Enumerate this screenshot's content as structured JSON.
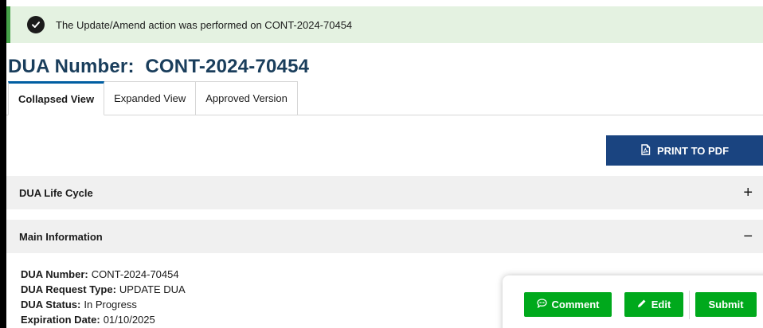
{
  "alert": {
    "icon": "check-circle-icon",
    "message": "The Update/Amend action was performed on CONT-2024-70454",
    "color": "#46a249"
  },
  "page_title": "DUA Number:  CONT-2024-70454",
  "tabs": [
    {
      "label": "Collapsed View",
      "active": true
    },
    {
      "label": "Expanded View",
      "active": false
    },
    {
      "label": "Approved Version",
      "active": false
    }
  ],
  "print_button": {
    "label": "PRINT TO PDF",
    "icon": "pdf-file-icon"
  },
  "sections": {
    "life_cycle": {
      "title": "DUA Life Cycle",
      "toggle": "+"
    },
    "main_info": {
      "title": "Main Information",
      "toggle": "−"
    }
  },
  "main_info": [
    {
      "label": "DUA Number:",
      "value": "CONT-2024-70454"
    },
    {
      "label": "DUA Request Type:",
      "value": "UPDATE DUA"
    },
    {
      "label": "DUA Status:",
      "value": "In Progress"
    },
    {
      "label": "Expiration Date:",
      "value": "01/10/2025"
    }
  ],
  "actions": {
    "comment": "Comment",
    "edit": "Edit",
    "submit": "Submit",
    "color": "#00a91c"
  },
  "colors": {
    "title": "#1a3e5c",
    "primary_button": "#1a4480",
    "tab_active": "#005ea2",
    "accordion_bg": "#f0f0f0"
  }
}
